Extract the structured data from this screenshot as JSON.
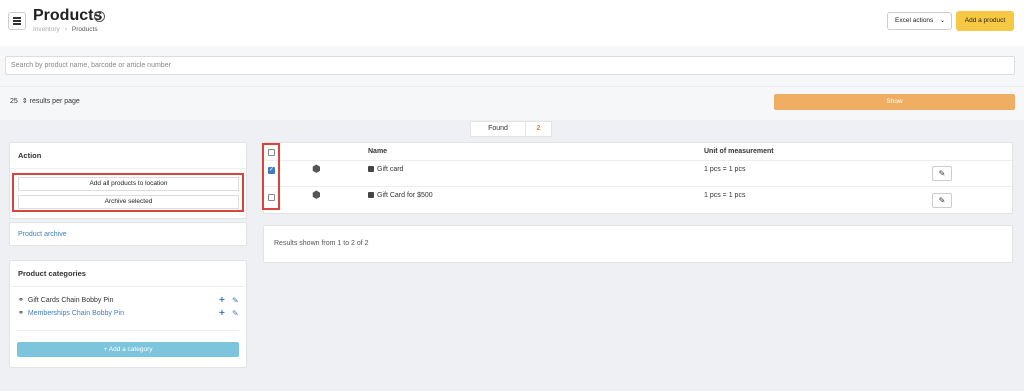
{
  "header": {
    "title": "Products",
    "breadcrumb": [
      "Inventory",
      "Products"
    ],
    "excel_label": "Excel actions",
    "add_label": "Add a product"
  },
  "search": {
    "placeholder": "Search by product name, barcode or article number"
  },
  "pagination": {
    "per_page": "25",
    "per_page_label": "results per page",
    "show_label": "Show"
  },
  "found": {
    "label": "Found",
    "count": "2"
  },
  "action_panel": {
    "title": "Action",
    "buttons": [
      "Add all products to location",
      "Archive selected"
    ],
    "archive_link": "Product archive"
  },
  "categories": {
    "title": "Product categories",
    "items": [
      {
        "label": "Gift Cards Chain Bobby Pin",
        "link": false
      },
      {
        "label": "Memberships Chain Bobby Pin",
        "link": true
      }
    ],
    "add_label": "+ Add a category"
  },
  "table": {
    "columns": [
      "Name",
      "Unit of measurement"
    ],
    "rows": [
      {
        "name": "Gift card",
        "unit": "1 pcs = 1 pcs",
        "checked": true
      },
      {
        "name": "Gift Card for $500",
        "unit": "1 pcs = 1 pcs",
        "checked": false
      }
    ],
    "summary": "Results shown from 1 to 2 of 2"
  },
  "colors": {
    "accent": "#f7c843",
    "show": "#efae63",
    "link": "#3c7dc4",
    "highlight": "#d9453b"
  }
}
